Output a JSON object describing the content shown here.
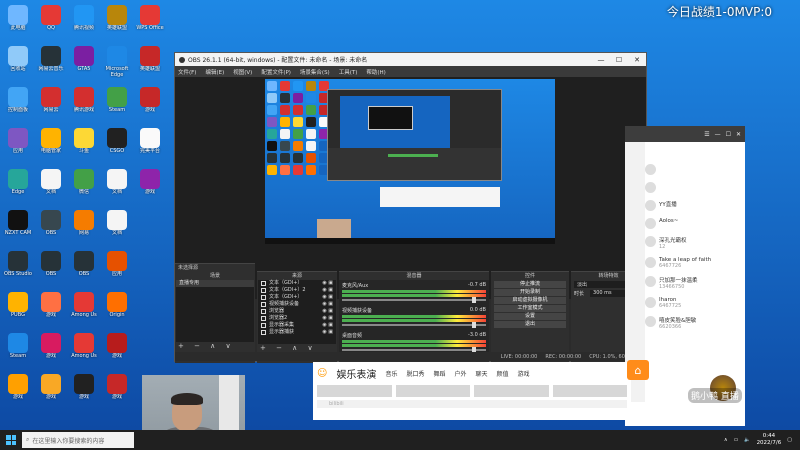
{
  "overlay": {
    "score_text": "今日战绩1-0MVP:0"
  },
  "desktop_icons": [
    {
      "label": "此电脑",
      "color": "#6fb7ff"
    },
    {
      "label": "QQ",
      "color": "#e53935"
    },
    {
      "label": "腾讯视频",
      "color": "#2196f3"
    },
    {
      "label": "英雄联盟",
      "color": "#b8860b"
    },
    {
      "label": "WPS Office",
      "color": "#e53935"
    },
    {
      "label": "回收站",
      "color": "#90caf9"
    },
    {
      "label": "网易云音乐",
      "color": "#263238"
    },
    {
      "label": "GTA5",
      "color": "#7b1fa2"
    },
    {
      "label": "Microsoft Edge",
      "color": "#1e88e5"
    },
    {
      "label": "英雄联盟",
      "color": "#c62828"
    },
    {
      "label": "控制面板",
      "color": "#42a5f5"
    },
    {
      "label": "网易云",
      "color": "#d32f2f"
    },
    {
      "label": "腾讯游戏",
      "color": "#d32f2f"
    },
    {
      "label": "Steam",
      "color": "#43a047"
    },
    {
      "label": "游戏",
      "color": "#c62828"
    },
    {
      "label": "应用",
      "color": "#7e57c2"
    },
    {
      "label": "电脑管家",
      "color": "#ffb300"
    },
    {
      "label": "斗鱼",
      "color": "#fdd835"
    },
    {
      "label": "CSGO",
      "color": "#212121"
    },
    {
      "label": "完美平台",
      "color": "#fafafa"
    },
    {
      "label": "Edge",
      "color": "#26a69a"
    },
    {
      "label": "文档",
      "color": "#f5f5f5"
    },
    {
      "label": "微信",
      "color": "#43a047"
    },
    {
      "label": "文档",
      "color": "#f5f5f5"
    },
    {
      "label": "游戏",
      "color": "#8e24aa"
    },
    {
      "label": "NZXT CAM",
      "color": "#111111"
    },
    {
      "label": "OBS",
      "color": "#37474f"
    },
    {
      "label": "网易",
      "color": "#f57c00"
    },
    {
      "label": "文档",
      "color": "#f5f5f5"
    },
    {
      "label": "",
      "color": "transparent"
    },
    {
      "label": "OBS Studio",
      "color": "#263238"
    },
    {
      "label": "OBS",
      "color": "#263238"
    },
    {
      "label": "OBS",
      "color": "#263238"
    },
    {
      "label": "应用",
      "color": "#e65100"
    },
    {
      "label": "",
      "color": "transparent"
    },
    {
      "label": "PUBG",
      "color": "#ffb300"
    },
    {
      "label": "游戏",
      "color": "#ff7043"
    },
    {
      "label": "Among Us",
      "color": "#e53935"
    },
    {
      "label": "Origin",
      "color": "#ff6f00"
    },
    {
      "label": "",
      "color": "transparent"
    },
    {
      "label": "Steam",
      "color": "#1e88e5"
    },
    {
      "label": "游戏",
      "color": "#d81b60"
    },
    {
      "label": "Among Us",
      "color": "#e53935"
    },
    {
      "label": "游戏",
      "color": "#b71c1c"
    },
    {
      "label": "",
      "color": "transparent"
    },
    {
      "label": "游戏",
      "color": "#ffa000"
    },
    {
      "label": "游戏",
      "color": "#f9a825"
    },
    {
      "label": "游戏",
      "color": "#212121"
    },
    {
      "label": "游戏",
      "color": "#c62828"
    },
    {
      "label": "",
      "color": "transparent"
    }
  ],
  "obs": {
    "title": "OBS 26.1.1 (64-bit, windows) - 配置文件: 未命名 - 场景: 未命名",
    "menu": [
      "文件(F)",
      "编辑(E)",
      "视图(V)",
      "配置文件(P)",
      "场景集合(S)",
      "工具(T)",
      "帮助(H)"
    ],
    "window_controls": [
      "—",
      "☐",
      "✕"
    ],
    "mid_controls": [
      "属性",
      "滤镜"
    ],
    "docks": {
      "scenes": {
        "header": "场景",
        "items": [
          "直播专用"
        ]
      },
      "sources": {
        "header": "来源",
        "items": [
          "文本（GDI+）",
          "文本（GDI+）2",
          "文本（GDI+）",
          "视频捕获设备",
          "浏览器",
          "浏览器2",
          "显示器采集",
          "显示器捕获"
        ]
      },
      "mixer": {
        "header": "混音器",
        "channels": [
          {
            "name": "麦克风/Aux",
            "db": "-0.7 dB"
          },
          {
            "name": "视频捕获设备",
            "db": "0.0 dB"
          },
          {
            "name": "桌面音频",
            "db": "-3.0 dB"
          }
        ]
      },
      "controls": {
        "header": "控件",
        "buttons": [
          "停止推流",
          "开始录制",
          "启动虚拟摄像机",
          "工作室模式",
          "设置",
          "退出"
        ]
      },
      "transitions": {
        "header": "转场特效",
        "type": "淡出",
        "duration_label": "时长",
        "duration": "300 ms"
      },
      "footer_symbols": "+ − ∧ ∨",
      "scene_label": "未选择源"
    },
    "status": [
      "LIVE: 00:00:00",
      "REC: 00:00:00",
      "CPU: 1.0%, 60.00 fps"
    ]
  },
  "live_room": {
    "chat": [
      {
        "name": "",
        "msg": ""
      },
      {
        "name": "",
        "msg": ""
      },
      {
        "name": "YY直播",
        "msg": ""
      },
      {
        "name": "Aolos~",
        "msg": ""
      },
      {
        "name": "深孔光霸权",
        "msg": "12"
      },
      {
        "name": "Take a leap of faith",
        "msg": "6467726"
      },
      {
        "name": "只加那一抹温柔",
        "msg": "13466750"
      },
      {
        "name": "Iharon",
        "msg": "6467725"
      },
      {
        "name": "嘻皮笑脸&胆敏",
        "msg": "6620366"
      }
    ]
  },
  "bili": {
    "smile": "☺",
    "title": "娱乐表演",
    "tabs": [
      "音乐",
      "脱口秀",
      "舞蹈",
      "户外",
      "聊天",
      "颜值",
      "游戏"
    ],
    "search_placeholder": "bilibili"
  },
  "watermark": "鹅小鸭 直播",
  "taskbar": {
    "search_placeholder": "在这里输入你要搜索的内容",
    "time": "0:44",
    "date": "2022/7/6"
  }
}
